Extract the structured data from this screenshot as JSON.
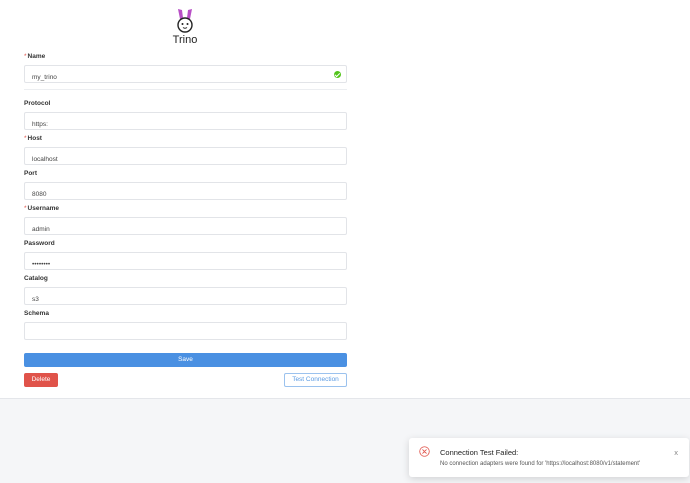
{
  "app": {
    "title": "Trino",
    "logo_icon": "trino-bunny-logo"
  },
  "form": {
    "name": {
      "label": "Name",
      "required": true,
      "value": "my_trino"
    },
    "protocol": {
      "label": "Protocol",
      "required": false,
      "value": "https:"
    },
    "host": {
      "label": "Host",
      "required": true,
      "value": "localhost"
    },
    "port": {
      "label": "Port",
      "required": false,
      "value": "8080"
    },
    "username": {
      "label": "Username",
      "required": true,
      "value": "admin"
    },
    "password": {
      "label": "Password",
      "required": false,
      "value": "••••••••"
    },
    "catalog": {
      "label": "Catalog",
      "required": false,
      "value": "s3"
    },
    "schema": {
      "label": "Schema",
      "required": false,
      "value": ""
    },
    "required_marker": "*"
  },
  "actions": {
    "save_label": "Save",
    "delete_label": "Delete",
    "test_label": "Test Connection"
  },
  "notification": {
    "title": "Connection Test Failed:",
    "message": "No connection adapters were found for 'https://localhost:8080/v1/statement'",
    "close_label": "x",
    "icon": "error-circle-x-icon"
  },
  "colors": {
    "primary": "#4a90e2",
    "danger": "#e0534a",
    "success": "#52c41a",
    "logo_accent": "#b84fc6"
  }
}
